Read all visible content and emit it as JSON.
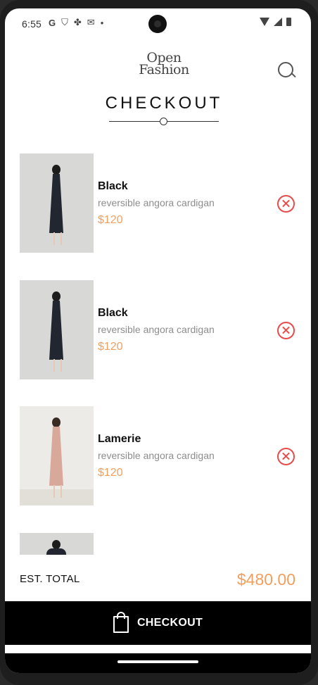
{
  "status_bar": {
    "time": "6:55",
    "notification_icons": [
      "google-icon",
      "vpn-shield-icon",
      "pinwheel-icon",
      "gmail-icon",
      "dot-icon"
    ]
  },
  "header": {
    "logo_line1": "Open",
    "logo_line2": "Fashion",
    "title": "CHECKOUT"
  },
  "items": [
    {
      "name": "Black",
      "description": "reversible angora cardigan",
      "price": "$120"
    },
    {
      "name": "Black",
      "description": "reversible angora cardigan",
      "price": "$120"
    },
    {
      "name": "Lamerie",
      "description": "reversible angora cardigan",
      "price": "$120"
    }
  ],
  "footer": {
    "total_label": "EST. TOTAL",
    "total_value": "$480.00",
    "checkout_label": "CHECKOUT"
  },
  "colors": {
    "accent_price": "#f19f5e",
    "remove_red": "#e84b4b",
    "checkout_bg": "#000000"
  }
}
